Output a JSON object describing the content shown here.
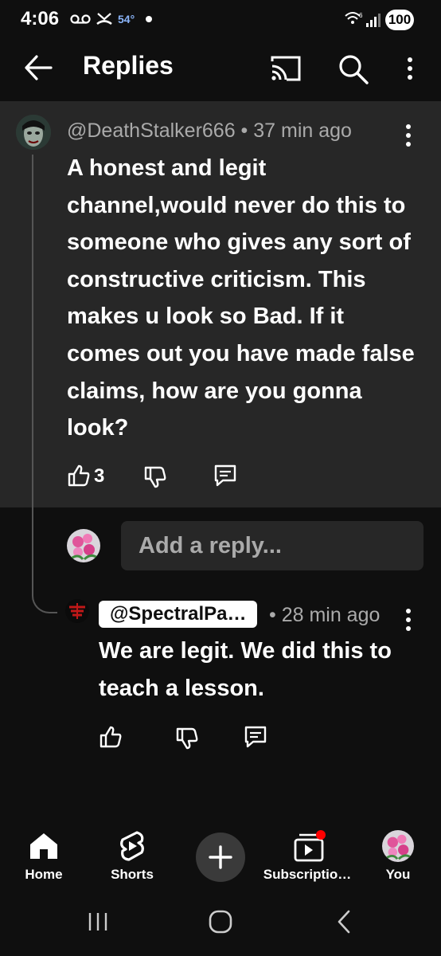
{
  "status_bar": {
    "time": "4:06",
    "temperature": "54°",
    "battery": "100"
  },
  "app_bar": {
    "title": "Replies",
    "icons": [
      "back-arrow-icon",
      "cast-icon",
      "search-icon",
      "more-vert-icon"
    ]
  },
  "comment": {
    "author": "@DeathStalker666",
    "age": "37 min ago",
    "meta_separator": " • ",
    "text": "A honest and legit channel,would never do this to someone who gives any sort of constructive criticism. This makes u look so Bad. If it comes out you have made false claims, how are you gonna look?",
    "likes": "3"
  },
  "reply_input": {
    "placeholder": "Add a reply..."
  },
  "reply": {
    "author": "@SpectralPa…",
    "age": "• 28 min ago",
    "text": "We are legit. We did this to teach a lesson."
  },
  "bottom_nav": {
    "items": [
      {
        "label": "Home",
        "icon": "home-icon"
      },
      {
        "label": "Shorts",
        "icon": "shorts-icon"
      },
      {
        "label": "",
        "icon": "create-plus-icon"
      },
      {
        "label": "Subscriptio…",
        "icon": "subscriptions-icon"
      },
      {
        "label": "You",
        "icon": "profile-avatar"
      }
    ]
  },
  "colors": {
    "background": "#0f0f0f",
    "comment_highlight": "#272727",
    "secondary_text": "#aaaaaa",
    "notification_dot": "#ff0000"
  }
}
